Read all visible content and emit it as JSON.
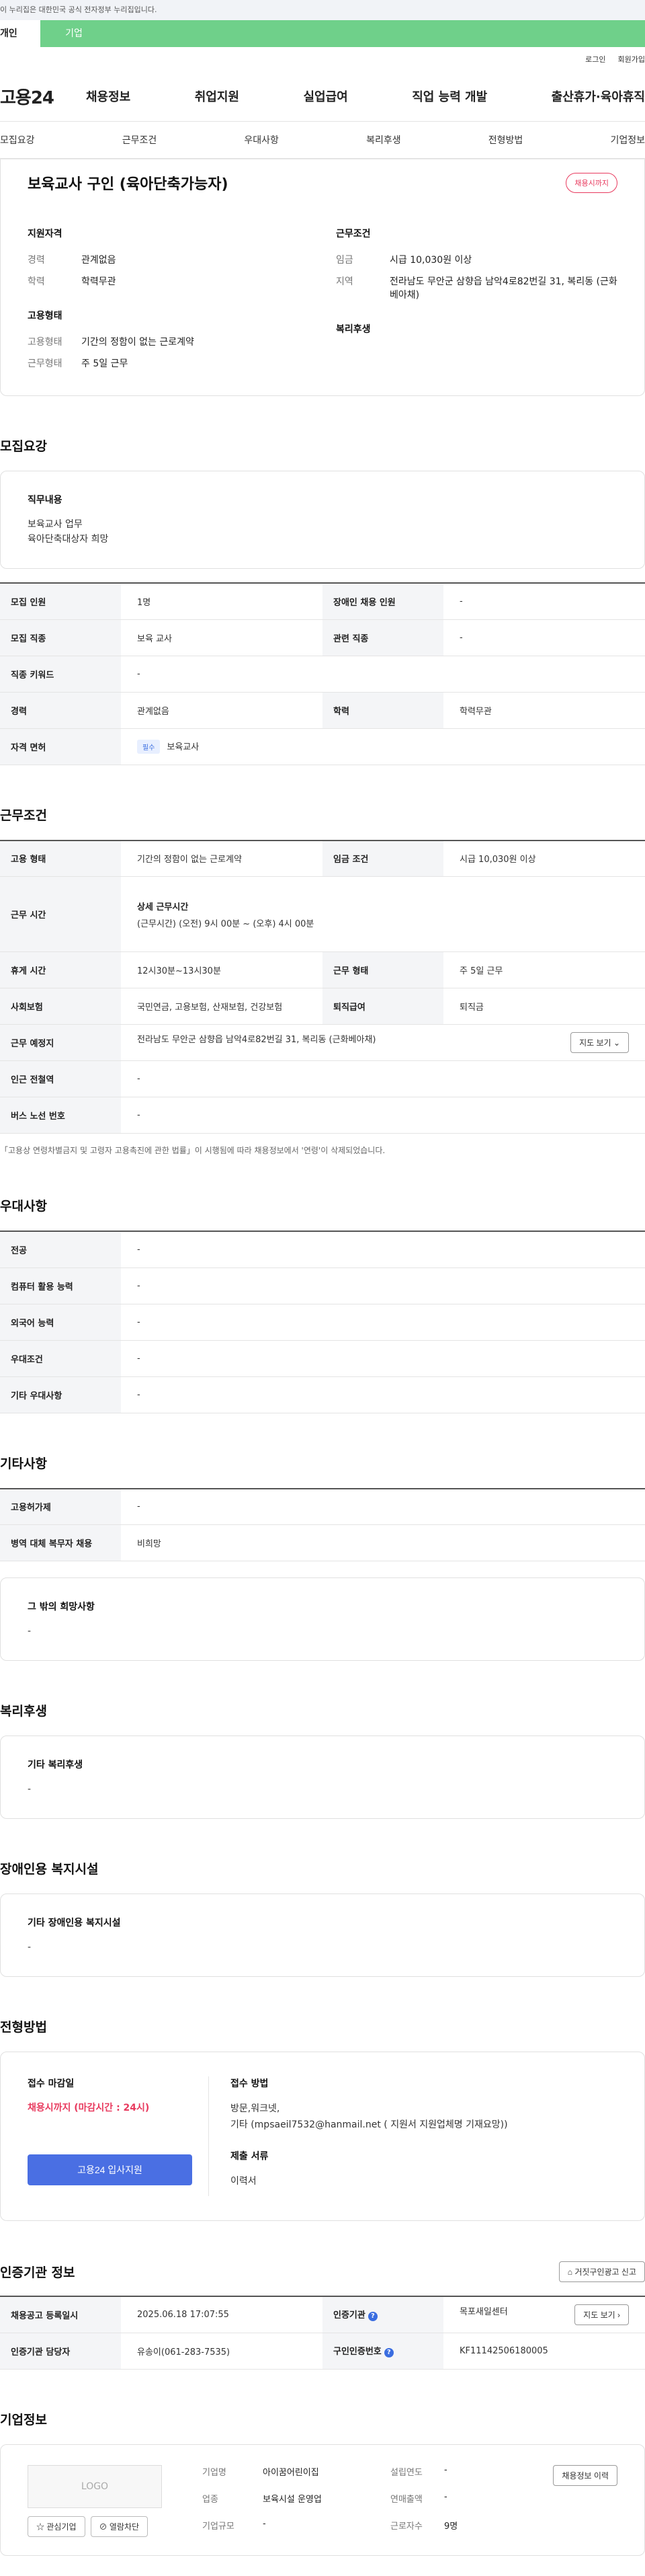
{
  "banner": "이 누리집은 대한민국 공식 전자정부 누리집입니다.",
  "user_tabs": [
    "개인",
    "기업"
  ],
  "util": [
    "로그인",
    "회원가입"
  ],
  "logo": "고용24",
  "gnb": [
    "채용정보",
    "취업지원",
    "실업급여",
    "직업 능력 개발",
    "출산휴가·육아휴직"
  ],
  "anchors": [
    "모집요강",
    "근무조건",
    "우대사항",
    "복리후생",
    "전형방법",
    "기업정보"
  ],
  "job": {
    "title": "보육교사 구인 (육아단축가능자)",
    "status": "채용시까지",
    "qual_title": "지원자격",
    "qual": [
      {
        "k": "경력",
        "v": "관계없음"
      },
      {
        "k": "학력",
        "v": "학력무관"
      }
    ],
    "cond_title": "근무조건",
    "cond": [
      {
        "k": "임금",
        "v": "시급 10,030원 이상"
      },
      {
        "k": "지역",
        "v": "전라남도 무안군 삼향읍 남악4로82번길 31, 복리동 (근화베아채)"
      }
    ],
    "emp_title": "고용형태",
    "emp": [
      {
        "k": "고용형태",
        "v": "기간의 정함이 없는 근로계약"
      },
      {
        "k": "근무형태",
        "v": "주 5일 근무"
      }
    ],
    "welfare_title": "복리후생"
  },
  "recruit": {
    "title": "모집요강",
    "duty_title": "직무내용",
    "duty_line1": "보육교사 업무",
    "duty_line2": "육아단축대상자 희망",
    "table": [
      {
        "k1": "모집 인원",
        "v1": "1명",
        "k2": "장애인 채용 인원",
        "v2": "-"
      },
      {
        "k1": "모집 직종",
        "v1": "보육 교사",
        "k2": "관련 직종",
        "v2": "-"
      },
      {
        "k1": "직종 키워드",
        "v1": "-"
      },
      {
        "k1": "경력",
        "v1": "관계없음",
        "k2": "학력",
        "v2": "학력무관"
      },
      {
        "k1": "자격 면허",
        "tag": "필수",
        "v1": "보육교사"
      }
    ]
  },
  "work": {
    "title": "근무조건",
    "r1": {
      "k1": "고용 형태",
      "v1": "기간의 정함이 없는 근로계약",
      "k2": "임금 조건",
      "v2": "시급 10,030원 이상"
    },
    "r2": {
      "k": "근무 시간",
      "sub": "상세 근무시간",
      "v": "(근무시간) (오전) 9시 00분 ~ (오후) 4시 00분"
    },
    "r3": {
      "k1": "휴게 시간",
      "v1": "12시30분~13시30분",
      "k2": "근무 형태",
      "v2": "주 5일 근무"
    },
    "r4": {
      "k1": "사회보험",
      "v1": "국민연금, 고용보험, 산재보험, 건강보험",
      "k2": "퇴직급여",
      "v2": "퇴직금"
    },
    "r5": {
      "k": "근무 예정지",
      "v": "전라남도 무안군 삼향읍 남악4로82번길 31, 복리동 (근화베아채)",
      "btn": "지도 보기"
    },
    "r6": {
      "k": "인근 전철역",
      "v": "-"
    },
    "r7": {
      "k": "버스 노선 번호",
      "v": "-"
    },
    "note": "「고용상 연령차별금지 및 고령자 고용촉진에 관한 법률」이 시행됨에 따라 채용정보에서 '연령'이 삭제되었습니다."
  },
  "pref": {
    "title": "우대사항",
    "rows": [
      {
        "k": "전공",
        "v": "-"
      },
      {
        "k": "컴퓨터 활용 능력",
        "v": "-"
      },
      {
        "k": "외국어 능력",
        "v": "-"
      },
      {
        "k": "우대조건",
        "v": "-"
      },
      {
        "k": "기타 우대사항",
        "v": "-"
      }
    ]
  },
  "etc": {
    "title": "기타사항",
    "rows": [
      {
        "k": "고용허가제",
        "v": "-"
      },
      {
        "k": "병역 대체 복무자 채용",
        "v": "비희망"
      }
    ],
    "other_title": "그 밖의 희망사항",
    "other_value": "-"
  },
  "welfare": {
    "title": "복리후생",
    "sub": "기타 복리후생",
    "value": "-"
  },
  "disabled": {
    "title": "장애인용 복지시설",
    "sub": "기타 장애인용 복지시설",
    "value": "-"
  },
  "selection": {
    "title": "전형방법",
    "deadline_title": "접수 마감일",
    "deadline": "채용시까지 (마감시간 : 24시)",
    "apply_btn": "고용24 입사지원",
    "method_title": "접수 방법",
    "method_line1": "방문,워크넷,",
    "method_line2": "기타 (mpsaeil7532@hanmail.net ( 지원서 지원업체명 기재요망))",
    "docs_title": "제출 서류",
    "docs": "이력서"
  },
  "cert": {
    "title": "인증기관 정보",
    "report_btn": "거짓구인광고 신고",
    "r1": {
      "k1": "채용공고 등록일시",
      "v1": "2025.06.18 17:07:55",
      "k2": "인증기관",
      "v2": "목포새일센터",
      "btn": "지도 보기"
    },
    "r2": {
      "k1": "인증기관 담당자",
      "v1": "유송이(061-283-7535)",
      "k2": "구인인증번호",
      "v2": "KF11142506180005"
    }
  },
  "company": {
    "title": "기업정보",
    "logo_text": "LOGO",
    "fav_btn": "관심기업",
    "view_btn": "열람차단",
    "history_btn": "채용정보 이력",
    "fields": [
      {
        "k": "기업명",
        "v": "아이꿈어린이집",
        "k2": "설립연도",
        "v2": "-"
      },
      {
        "k": "업종",
        "v": "보육시설 운영업",
        "k2": "연매출액",
        "v2": "-"
      },
      {
        "k": "기업규모",
        "v": "-",
        "k2": "근로자수",
        "v2": "9명"
      }
    ]
  }
}
